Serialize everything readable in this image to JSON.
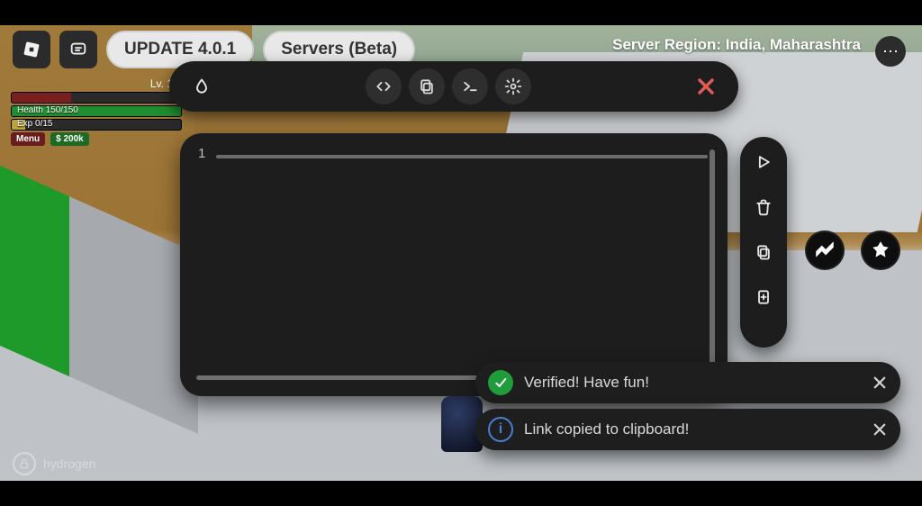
{
  "topbar": {
    "update_label": "UPDATE 4.0.1",
    "servers_label": "Servers (Beta)"
  },
  "server_region": {
    "prefix": "Server Region:",
    "value": "India, Maharashtra"
  },
  "hud": {
    "level_label": "Lv. 1",
    "health_label": "Health 150/150",
    "exp_label": "Exp 0/15",
    "menu_label": "Menu",
    "cash_label": "$ 200k"
  },
  "editor": {
    "line_number": "1"
  },
  "toasts": {
    "verified": "Verified! Have fun!",
    "link_copied": "Link copied to clipboard!"
  },
  "watermark": {
    "name": "hydrogen"
  },
  "icons": {
    "code": "code-icon",
    "copy": "copy-icon",
    "terminal": "terminal-icon",
    "gear": "gear-icon",
    "close": "close-icon",
    "play": "play-icon",
    "trash": "trash-icon",
    "paste": "paste-icon",
    "newfile": "newfile-icon",
    "drop": "drop-icon"
  }
}
